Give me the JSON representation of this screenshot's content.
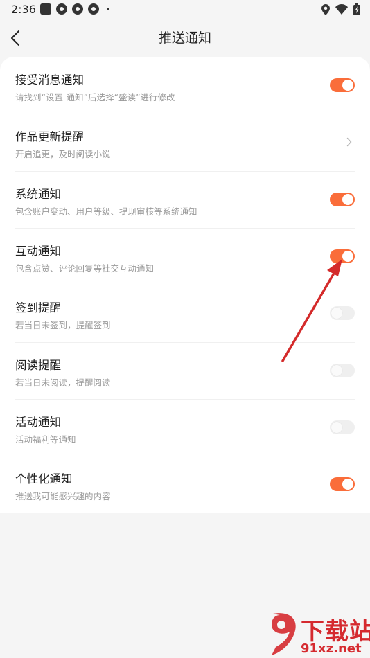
{
  "status_bar": {
    "time": "2:36"
  },
  "nav": {
    "title": "推送通知",
    "back_icon": "back-arrow-icon"
  },
  "settings": [
    {
      "title": "接受消息通知",
      "subtitle": "请找到“设置-通知”后选择“盛读”进行修改",
      "control": "toggle",
      "enabled": true
    },
    {
      "title": "作品更新提醒",
      "subtitle": "开启追更，及时阅读小说",
      "control": "chevron"
    },
    {
      "title": "系统通知",
      "subtitle": "包含账户变动、用户等级、提现审核等系统通知",
      "control": "toggle",
      "enabled": true
    },
    {
      "title": "互动通知",
      "subtitle": "包含点赞、评论回复等社交互动通知",
      "control": "toggle",
      "enabled": true
    },
    {
      "title": "签到提醒",
      "subtitle": "若当日未签到，提醒签到",
      "control": "toggle",
      "enabled": false
    },
    {
      "title": "阅读提醒",
      "subtitle": "若当日未阅读，提醒阅读",
      "control": "toggle",
      "enabled": false
    },
    {
      "title": "活动通知",
      "subtitle": "活动福利等通知",
      "control": "toggle",
      "enabled": false
    },
    {
      "title": "个性化通知",
      "subtitle": "推送我可能感兴趣的内容",
      "control": "toggle",
      "enabled": true
    }
  ],
  "colors": {
    "accent": "#fa6d3a",
    "toggle_off": "#efefef",
    "annotation_arrow": "#d42a2a"
  },
  "watermark": {
    "line1": "下载站",
    "line2": "91xz.net"
  }
}
